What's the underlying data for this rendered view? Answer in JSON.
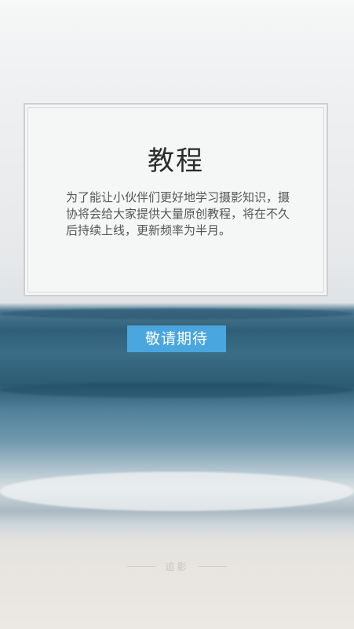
{
  "card": {
    "title": "教程",
    "body": "为了能让小伙伴们更好地学习摄影知识，摄协将会给大家提供大量原创教程，将在不久后持续上线，更新频率为半月。"
  },
  "button": {
    "label": "敬请期待"
  },
  "footer": {
    "brand": "追影"
  },
  "colors": {
    "accent": "#4aa6de"
  }
}
